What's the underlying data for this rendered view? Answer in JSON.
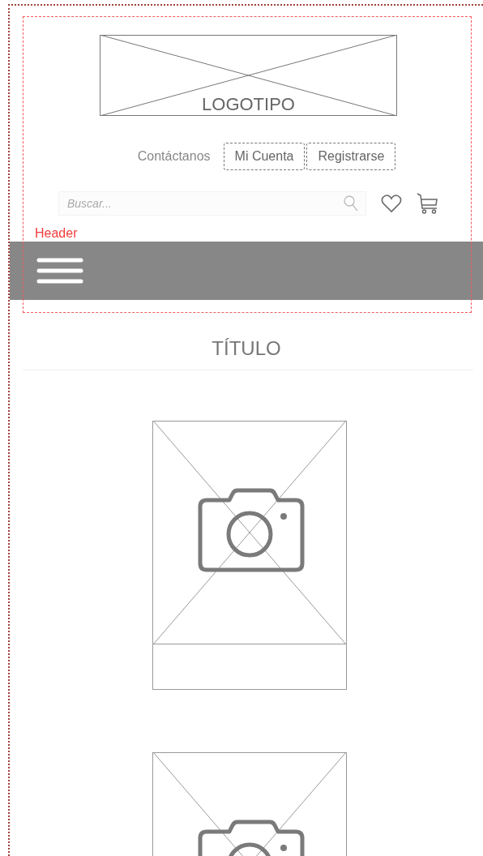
{
  "logo": {
    "text": "LOGOTIPO"
  },
  "nav": [
    {
      "label": "Contáctanos",
      "kind": "link"
    },
    {
      "label": "Mi Cuenta",
      "kind": "button"
    },
    {
      "label": "Registrarse",
      "kind": "button"
    }
  ],
  "search": {
    "placeholder": "Buscar..."
  },
  "header_label": "Header",
  "title": "TÍTULO",
  "products": [
    {
      "kind": "placeholder"
    },
    {
      "kind": "placeholder"
    }
  ]
}
